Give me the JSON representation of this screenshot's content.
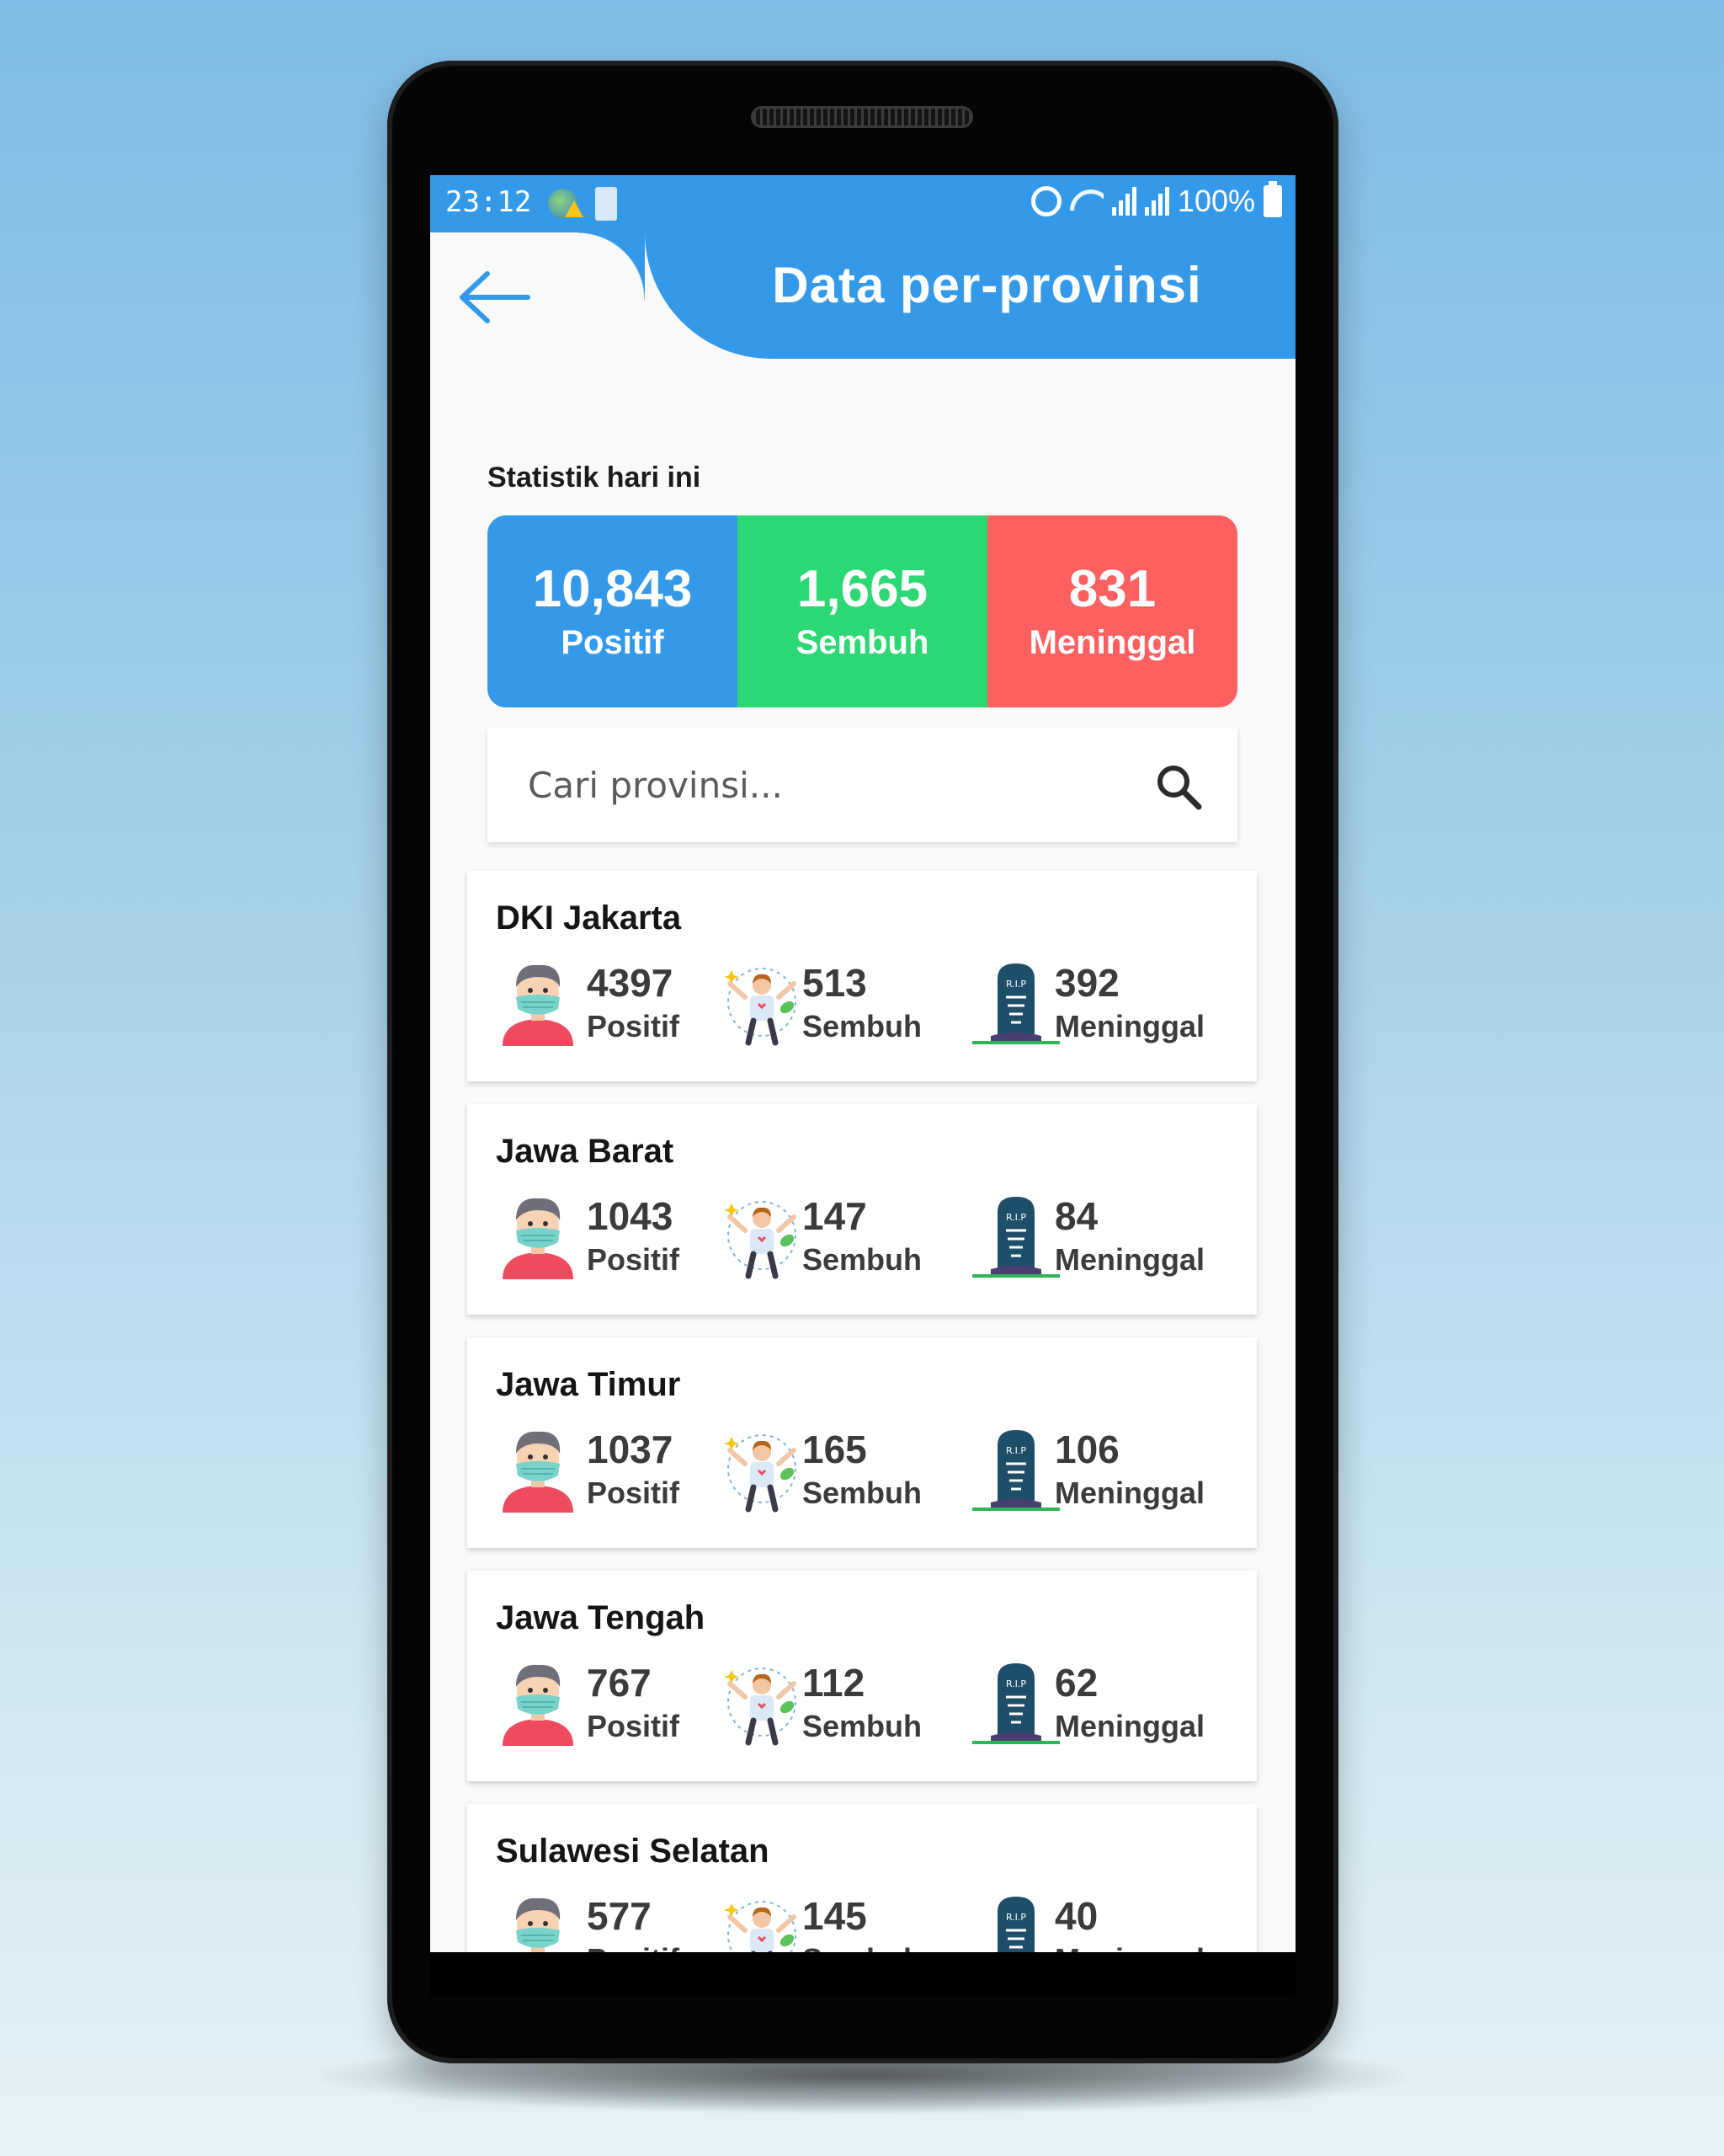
{
  "status_bar": {
    "time": "23:12",
    "battery_percent": "100%",
    "icons": [
      "globe-alert-icon",
      "battery-saver-icon",
      "alarm-icon",
      "wifi-icon",
      "signal-icon",
      "signal-icon",
      "battery-icon"
    ]
  },
  "header": {
    "title": "Data per-provinsi",
    "back_icon": "arrow-left-icon"
  },
  "stats": {
    "section_label": "Statistik hari ini",
    "positive": {
      "value": "10,843",
      "label": "Positif",
      "color": "#3599e9"
    },
    "recovered": {
      "value": "1,665",
      "label": "Sembuh",
      "color": "#2cd873"
    },
    "deaths": {
      "value": "831",
      "label": "Meninggal",
      "color": "#fd6061"
    }
  },
  "search": {
    "placeholder": "Cari provinsi...",
    "icon": "search-icon"
  },
  "provinces": [
    {
      "name": "DKI Jakarta",
      "positif": "4397",
      "sembuh": "513",
      "meninggal": "392"
    },
    {
      "name": "Jawa Barat",
      "positif": "1043",
      "sembuh": "147",
      "meninggal": "84"
    },
    {
      "name": "Jawa Timur",
      "positif": "1037",
      "sembuh": "165",
      "meninggal": "106"
    },
    {
      "name": "Jawa Tengah",
      "positif": "767",
      "sembuh": "112",
      "meninggal": "62"
    },
    {
      "name": "Sulawesi Selatan",
      "positif": "577",
      "sembuh": "145",
      "meninggal": "40"
    }
  ],
  "labels": {
    "positif": "Positif",
    "sembuh": "Sembuh",
    "meninggal": "Meninggal"
  }
}
